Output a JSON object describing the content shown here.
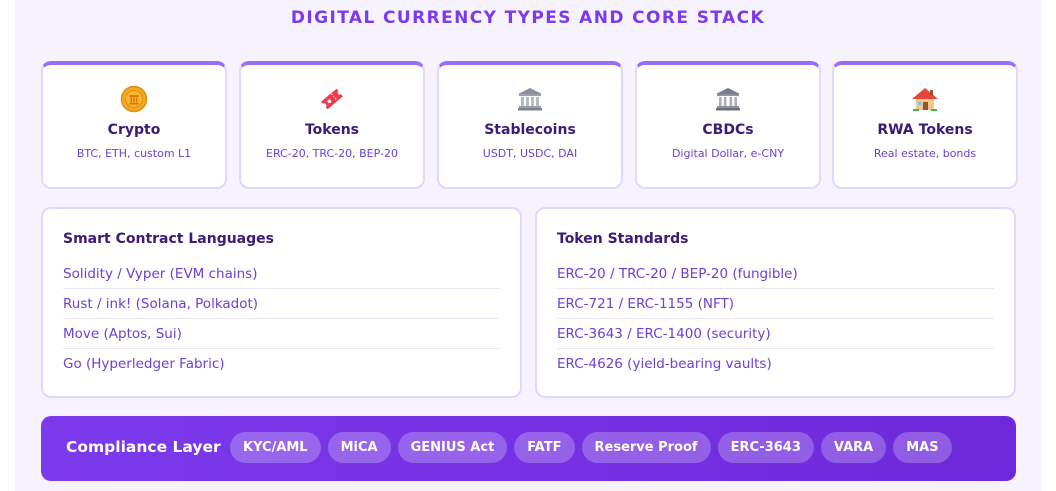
{
  "title": "DIGITAL CURRENCY TYPES AND CORE STACK",
  "cards": [
    {
      "icon": "coin-icon",
      "name": "Crypto",
      "desc": "BTC, ETH, custom L1"
    },
    {
      "icon": "ticket-icon",
      "name": "Tokens",
      "desc": "ERC-20, TRC-20, BEP-20"
    },
    {
      "icon": "bank-icon",
      "name": "Stablecoins",
      "desc": "USDT, USDC, DAI"
    },
    {
      "icon": "classical-building-icon",
      "name": "CBDCs",
      "desc": "Digital Dollar, e-CNY"
    },
    {
      "icon": "house-icon",
      "name": "RWA Tokens",
      "desc": "Real estate, bonds"
    }
  ],
  "smart_contract": {
    "heading": "Smart Contract Languages",
    "items": [
      "Solidity / Vyper (EVM chains)",
      "Rust / ink! (Solana, Polkadot)",
      "Move (Aptos, Sui)",
      "Go (Hyperledger Fabric)"
    ]
  },
  "token_standards": {
    "heading": "Token Standards",
    "items": [
      "ERC-20 / TRC-20 / BEP-20 (fungible)",
      "ERC-721 / ERC-1155 (NFT)",
      "ERC-3643 / ERC-1400 (security)",
      "ERC-4626 (yield-bearing vaults)"
    ]
  },
  "compliance": {
    "label": "Compliance Layer",
    "chips": [
      "KYC/AML",
      "MiCA",
      "GENIUS Act",
      "FATF",
      "Reserve Proof",
      "ERC-3643",
      "VARA",
      "MAS"
    ]
  },
  "colors": {
    "accent": "#7c3aed",
    "heading_text": "#3b1a78",
    "body_text": "#6d3fd6",
    "panel_bg": "#f6f2fe",
    "card_border": "#e2d7fb"
  }
}
